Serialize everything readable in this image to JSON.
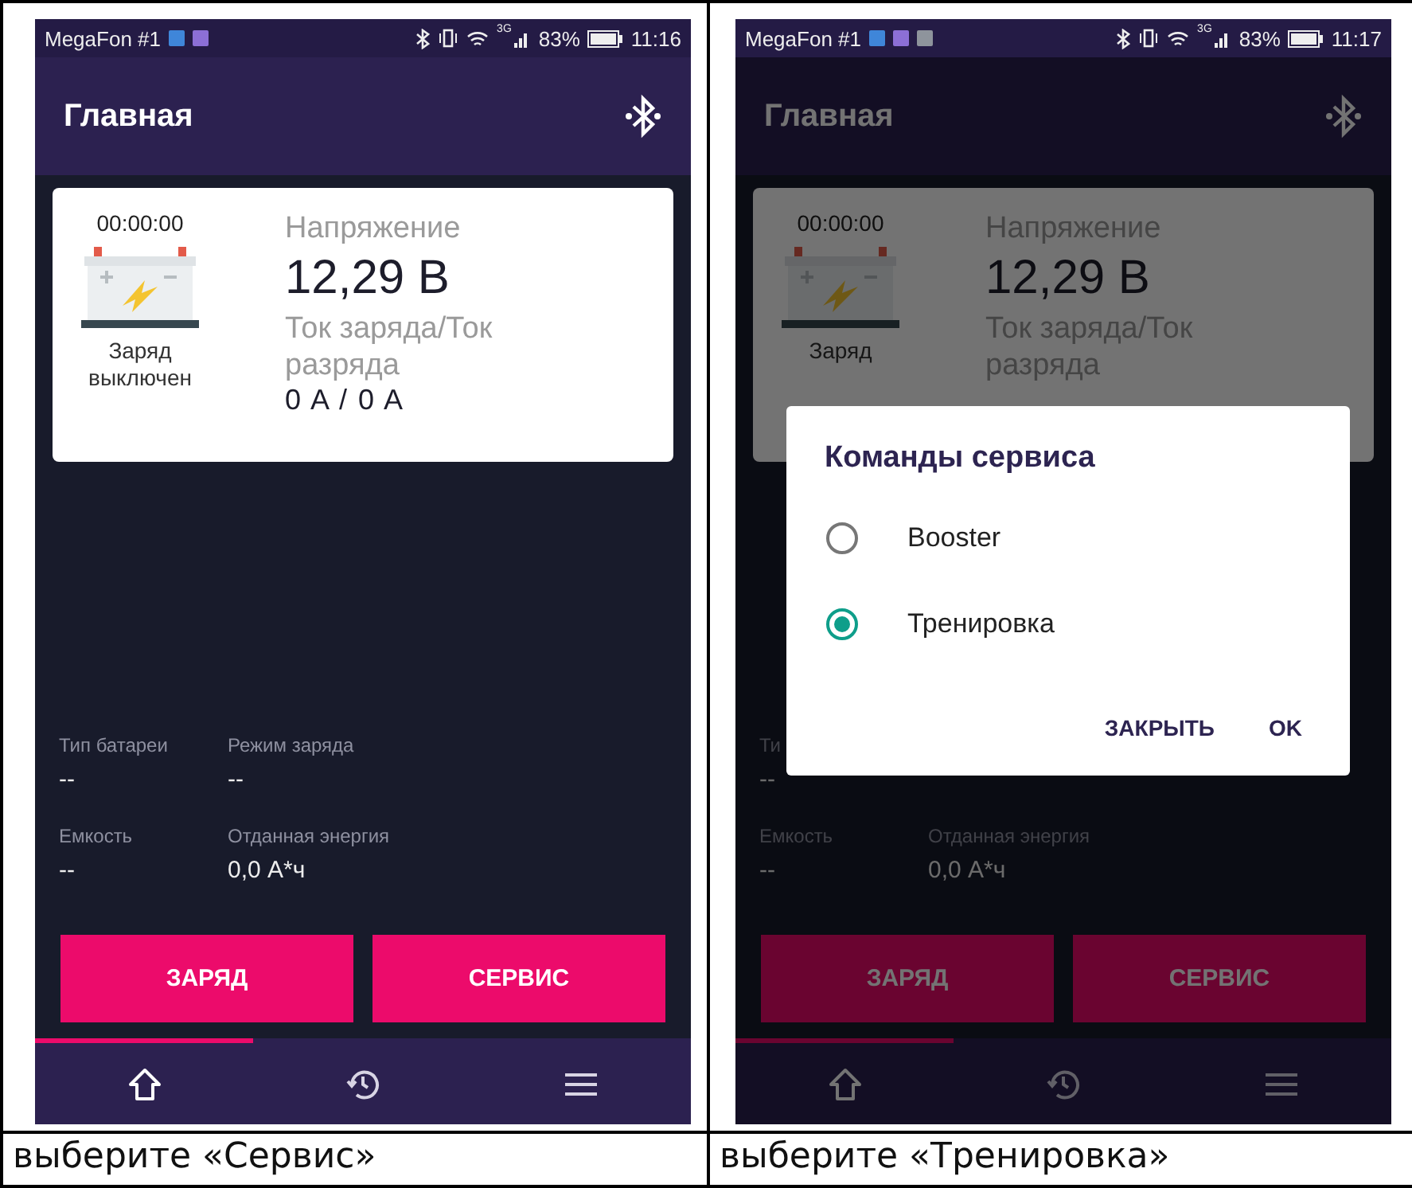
{
  "panels": [
    {
      "phone": {
        "status_bar": {
          "carrier": "MegaFon #1",
          "notifications": [
            {
              "color": "#3f86d9"
            },
            {
              "color": "#8c6fd6"
            }
          ],
          "network": "3G",
          "battery": "83%",
          "time": "11:16"
        },
        "app_bar": {
          "title": "Главная"
        },
        "card": {
          "timer": "00:00:00",
          "status": "Заряд выключен",
          "voltage_label": "Напряжение",
          "voltage": "12,29 В",
          "current_label": "Ток заряда/Ток разряда",
          "current": "0 A / 0 A"
        },
        "fields": [
          [
            {
              "label": "Тип батареи",
              "value": "--"
            },
            {
              "label": "Режим заряда",
              "value": "--"
            }
          ],
          [
            {
              "label": "Емкость",
              "value": "--"
            },
            {
              "label": "Отданная энергия",
              "value": "0,0 А*ч"
            }
          ]
        ],
        "buttons": [
          "ЗАРЯД",
          "СЕРВИС"
        ],
        "nav": [
          {
            "kind": "home",
            "selected": true
          },
          {
            "kind": "history",
            "selected": false
          },
          {
            "kind": "menu",
            "selected": false
          }
        ],
        "dimmed": false
      },
      "caption": "выберите «Сервис»"
    },
    {
      "phone": {
        "status_bar": {
          "carrier": "MegaFon #1",
          "notifications": [
            {
              "color": "#3f86d9"
            },
            {
              "color": "#8c6fd6"
            },
            {
              "color": "#8e949c"
            }
          ],
          "network": "3G",
          "battery": "83%",
          "time": "11:17"
        },
        "app_bar": {
          "title": "Главная"
        },
        "card": {
          "timer": "00:00:00",
          "status": "Заряд",
          "voltage_label": "Напряжение",
          "voltage": "12,29 В",
          "current_label": "Ток заряда/Ток разряда"
        },
        "fields": [
          [
            {
              "label": "Ти",
              "value": "--"
            }
          ],
          [
            {
              "label": "Емкость",
              "value": "--"
            },
            {
              "label": "Отданная энергия",
              "value": "0,0 А*ч"
            }
          ]
        ],
        "buttons": [
          "ЗАРЯД",
          "СЕРВИС"
        ],
        "nav": [
          {
            "kind": "home",
            "selected": true
          },
          {
            "kind": "history",
            "selected": false
          },
          {
            "kind": "menu",
            "selected": false
          }
        ],
        "dimmed": true,
        "dialog": {
          "title": "Команды сервиса",
          "options": [
            {
              "label": "Booster",
              "selected": false
            },
            {
              "label": "Тренировка",
              "selected": true
            }
          ],
          "actions": [
            "ЗАКРЫТЬ",
            "OK"
          ]
        }
      },
      "caption": "выберите «Тренировка»"
    }
  ]
}
